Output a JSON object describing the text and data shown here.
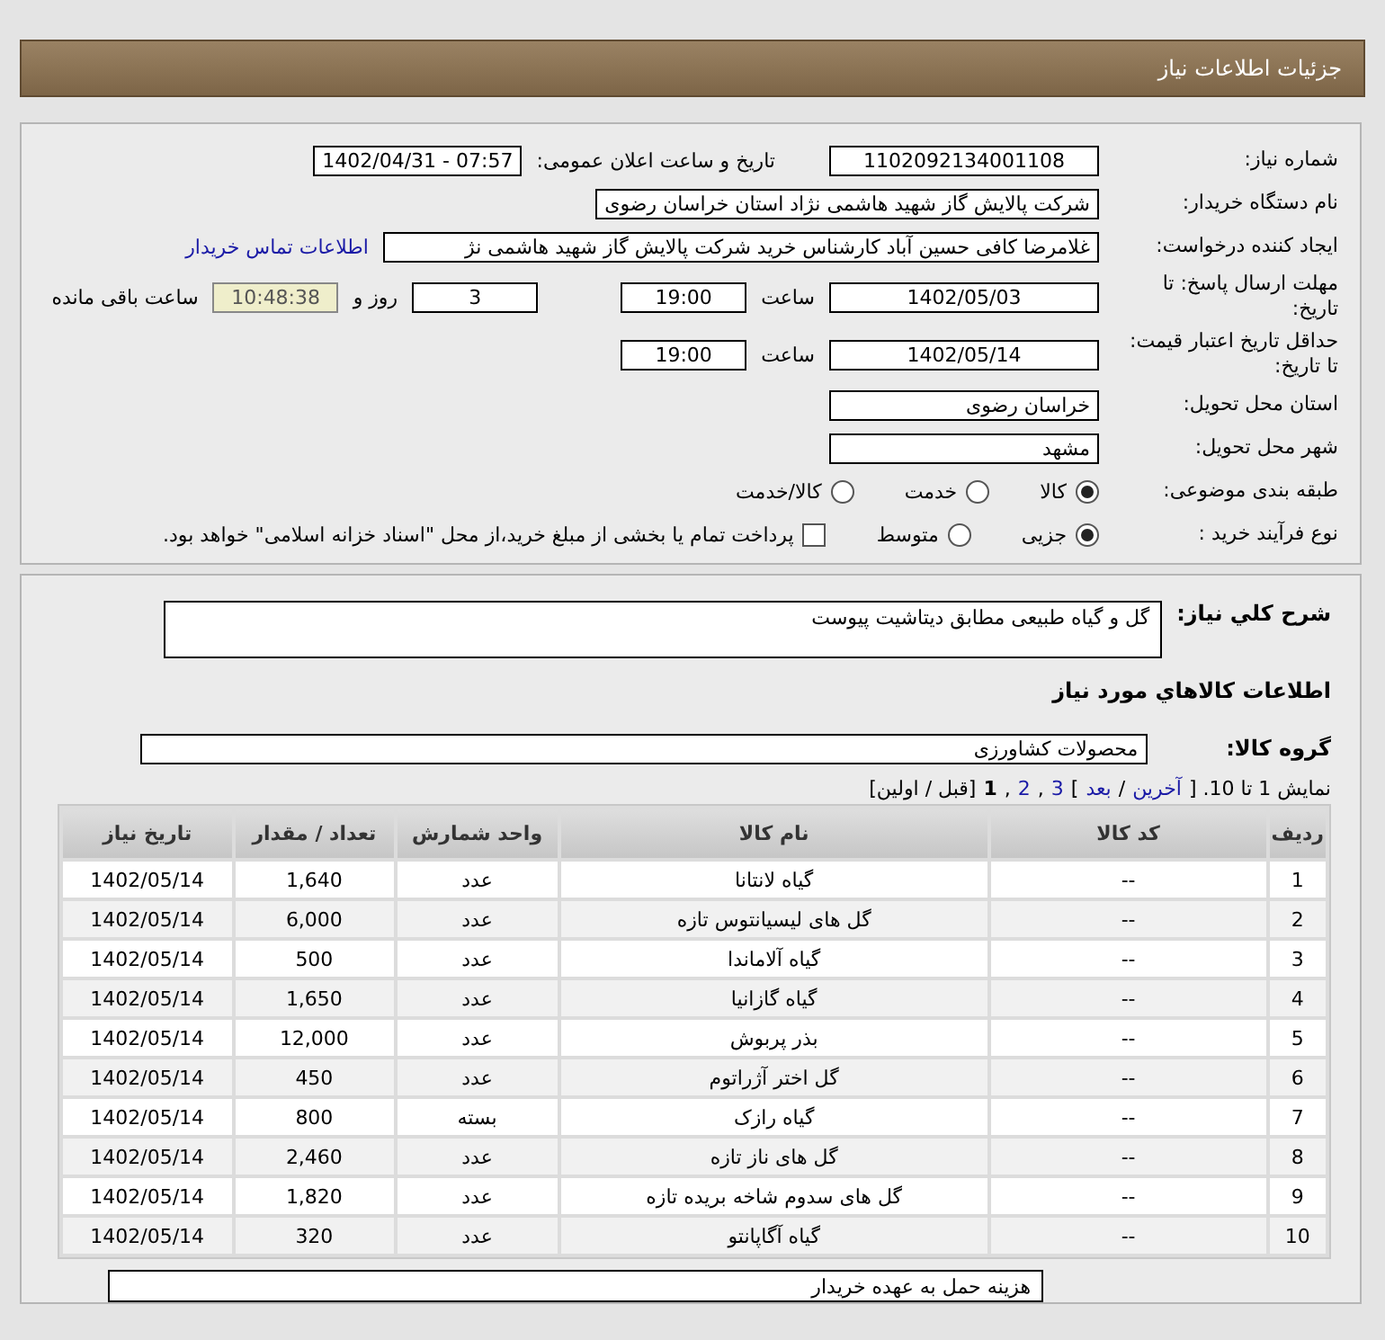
{
  "header": {
    "title": "جزئیات اطلاعات نیاز"
  },
  "need_number": {
    "label": "شماره نیاز:",
    "value": "1102092134001108"
  },
  "announce": {
    "label": "تاریخ و ساعت اعلان عمومی:",
    "value": "1402/04/31 - 07:57"
  },
  "buyer": {
    "label": "نام دستگاه خریدار:",
    "value": "شرکت پالایش گاز شهید هاشمی نژاد   استان خراسان رضوی"
  },
  "creator": {
    "label": "ایجاد کننده درخواست:",
    "value": "غلامرضا کافی حسین آباد کارشناس خرید  شرکت پالایش گاز شهید هاشمی نژ",
    "link": "اطلاعات تماس خریدار"
  },
  "deadline": {
    "label": "مهلت ارسال پاسخ: تا تاریخ:",
    "date": "1402/05/03",
    "time_label": "ساعت",
    "time": "19:00",
    "days": "3",
    "days_label": "روز و",
    "remaining": "10:48:38",
    "remaining_label": "ساعت باقی مانده"
  },
  "validity": {
    "label": "حداقل تاریخ اعتبار قیمت: تا تاریخ:",
    "date": "1402/05/14",
    "time_label": "ساعت",
    "time": "19:00"
  },
  "province": {
    "label": "استان محل تحویل:",
    "value": "خراسان رضوی"
  },
  "city": {
    "label": "شهر محل تحویل:",
    "value": "مشهد"
  },
  "category": {
    "label": "طبقه بندی موضوعی:",
    "options": [
      {
        "label": "کالا",
        "selected": true
      },
      {
        "label": "خدمت",
        "selected": false
      },
      {
        "label": "کالا/خدمت",
        "selected": false
      }
    ]
  },
  "process": {
    "label": "نوع فرآیند خرید :",
    "options": [
      {
        "label": "جزیی",
        "selected": true
      },
      {
        "label": "متوسط",
        "selected": false
      }
    ],
    "payment": {
      "label": "پرداخت تمام یا بخشی از مبلغ خرید،از محل \"اسناد خزانه اسلامی\" خواهد بود.",
      "checked": false
    }
  },
  "description": {
    "label": "شرح کلي نياز:",
    "value": "گل و گیاه طبیعی مطابق دیتاشیت پیوست"
  },
  "goods_heading": "اطلاعات کالاهاي مورد نياز",
  "group": {
    "label": "گروه کالا:",
    "value": "محصولات کشاورزی"
  },
  "pagination": [
    {
      "kind": "text",
      "text": "نمایش 1 تا 10. ["
    },
    {
      "kind": "link",
      "text": "آخرین"
    },
    {
      "kind": "text",
      "text": "/"
    },
    {
      "kind": "link",
      "text": "بعد"
    },
    {
      "kind": "text",
      "text": "]"
    },
    {
      "kind": "link",
      "text": "3"
    },
    {
      "kind": "text",
      "text": ","
    },
    {
      "kind": "link",
      "text": "2"
    },
    {
      "kind": "text",
      "text": ","
    },
    {
      "kind": "current",
      "text": "1"
    },
    {
      "kind": "text",
      "text": "[قبل / اولین]"
    }
  ],
  "table": {
    "columns": [
      "ردیف",
      "کد کالا",
      "نام کالا",
      "واحد شمارش",
      "تعداد / مقدار",
      "تاریخ نیاز"
    ],
    "rows": [
      [
        "1",
        "--",
        "گیاه لانتانا",
        "عدد",
        "1,640",
        "1402/05/14"
      ],
      [
        "2",
        "--",
        "گل های لیسیانتوس تازه",
        "عدد",
        "6,000",
        "1402/05/14"
      ],
      [
        "3",
        "--",
        "گیاه آلاماندا",
        "عدد",
        "500",
        "1402/05/14"
      ],
      [
        "4",
        "--",
        "گیاه گازانیا",
        "عدد",
        "1,650",
        "1402/05/14"
      ],
      [
        "5",
        "--",
        "بذر پربوش",
        "عدد",
        "12,000",
        "1402/05/14"
      ],
      [
        "6",
        "--",
        "گل اختر آژراتوم",
        "عدد",
        "450",
        "1402/05/14"
      ],
      [
        "7",
        "--",
        "گیاه رازک",
        "بسته",
        "800",
        "1402/05/14"
      ],
      [
        "8",
        "--",
        "گل های ناز تازه",
        "عدد",
        "2,460",
        "1402/05/14"
      ],
      [
        "9",
        "--",
        "گل های سدوم شاخه بریده تازه",
        "عدد",
        "1,820",
        "1402/05/14"
      ],
      [
        "10",
        "--",
        "گیاه آگاپانتو",
        "عدد",
        "320",
        "1402/05/14"
      ]
    ]
  },
  "note": "هزینه حمل به عهده خریدار"
}
